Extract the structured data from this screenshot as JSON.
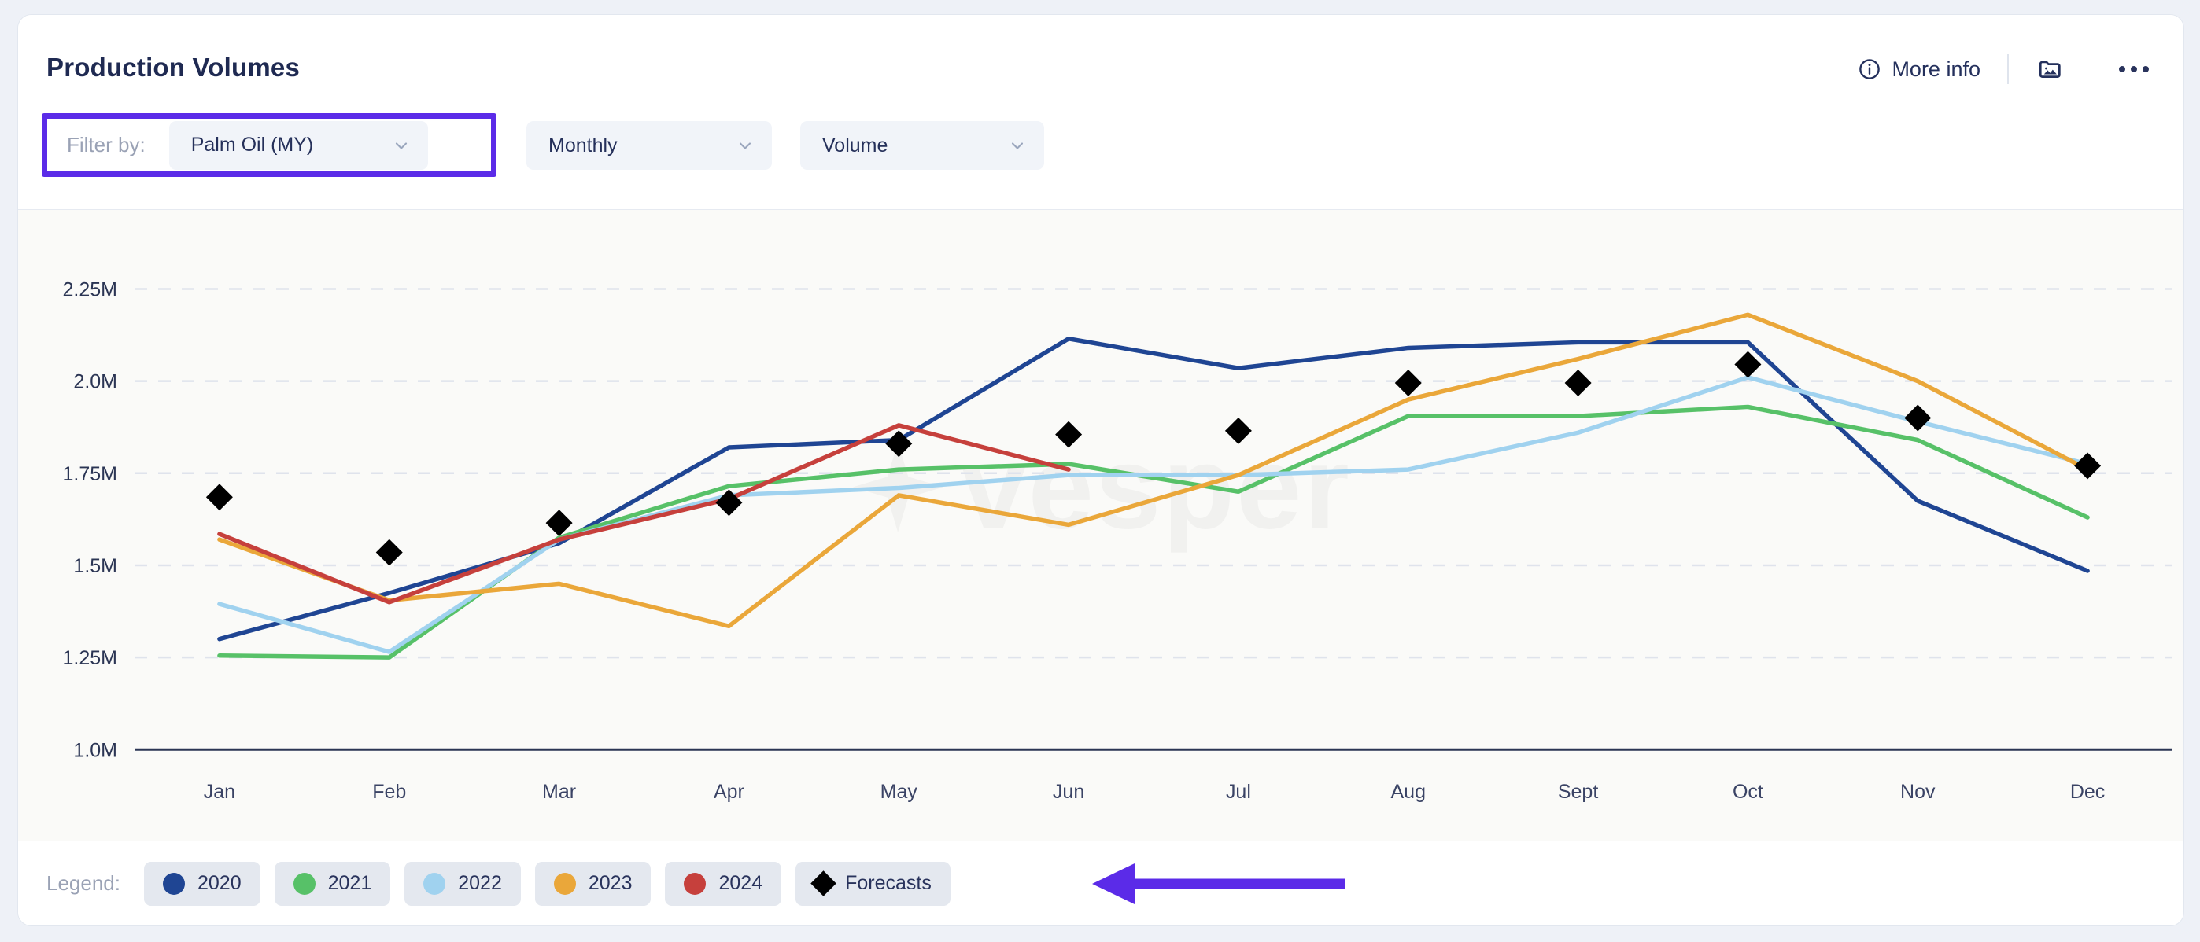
{
  "header": {
    "title": "Production Volumes",
    "more_info_label": "More info",
    "info_icon": "info-circle-icon",
    "image_icon": "image-folder-icon",
    "menu_icon": "ellipsis-icon"
  },
  "filters": {
    "label": "Filter by:",
    "highlight_color": "#5b2be8",
    "commodity": {
      "value": "Palm Oil (MY)",
      "icon": "chevron-down-icon"
    },
    "frequency": {
      "value": "Monthly",
      "icon": "chevron-down-icon"
    },
    "metric": {
      "value": "Volume",
      "icon": "chevron-down-icon"
    }
  },
  "legend": {
    "label": "Legend:",
    "items": [
      {
        "label": "2020",
        "color": "#1f4593",
        "marker": "circle"
      },
      {
        "label": "2021",
        "color": "#57c168",
        "marker": "circle"
      },
      {
        "label": "2022",
        "color": "#a0d2ef",
        "marker": "circle"
      },
      {
        "label": "2023",
        "color": "#eaa73a",
        "marker": "circle"
      },
      {
        "label": "2024",
        "color": "#c6403c",
        "marker": "circle"
      },
      {
        "label": "Forecasts",
        "color": "#000000",
        "marker": "diamond"
      }
    ]
  },
  "annotations": {
    "arrow_color": "#5b2be8",
    "watermark_text": "vesper"
  },
  "chart_data": {
    "type": "line",
    "title": "Production Volumes",
    "xlabel": "",
    "ylabel": "Volume",
    "ylim": [
      1000000,
      2375000
    ],
    "yticks": [
      2250000,
      2000000,
      1750000,
      1500000,
      1250000,
      1000000
    ],
    "ytick_labels": [
      "2.25M",
      "2.0M",
      "1.75M",
      "1.5M",
      "1.25M",
      "1.0M"
    ],
    "grid": true,
    "legend_position": "bottom",
    "categories": [
      "Jan",
      "Feb",
      "Mar",
      "Apr",
      "May",
      "Jun",
      "Jul",
      "Aug",
      "Sept",
      "Oct",
      "Nov",
      "Dec"
    ],
    "series": [
      {
        "name": "2020",
        "color": "#1f4593",
        "values": [
          1300000,
          1425000,
          1560000,
          1820000,
          1840000,
          2115000,
          2035000,
          2090000,
          2105000,
          2105000,
          1675000,
          1485000
        ]
      },
      {
        "name": "2021",
        "color": "#57c168",
        "values": [
          1255000,
          1250000,
          1575000,
          1715000,
          1760000,
          1775000,
          1700000,
          1905000,
          1905000,
          1930000,
          1840000,
          1630000
        ]
      },
      {
        "name": "2022",
        "color": "#a0d2ef",
        "values": [
          1395000,
          1265000,
          1570000,
          1690000,
          1710000,
          1745000,
          1745000,
          1760000,
          1860000,
          2010000,
          1890000,
          1775000
        ]
      },
      {
        "name": "2023",
        "color": "#eaa73a",
        "values": [
          1570000,
          1405000,
          1450000,
          1335000,
          1690000,
          1610000,
          1745000,
          1950000,
          2060000,
          2180000,
          2000000,
          1760000
        ]
      },
      {
        "name": "2024",
        "color": "#c6403c",
        "values": [
          1585000,
          1400000,
          1570000,
          1680000,
          1880000,
          1760000,
          null,
          null,
          null,
          null,
          null,
          null
        ]
      },
      {
        "name": "Forecasts",
        "color": "#000000",
        "marker": "diamond",
        "line": false,
        "values": [
          1685000,
          1535000,
          1615000,
          1670000,
          1830000,
          1855000,
          1865000,
          1995000,
          1995000,
          2045000,
          1900000,
          1770000
        ]
      }
    ]
  }
}
